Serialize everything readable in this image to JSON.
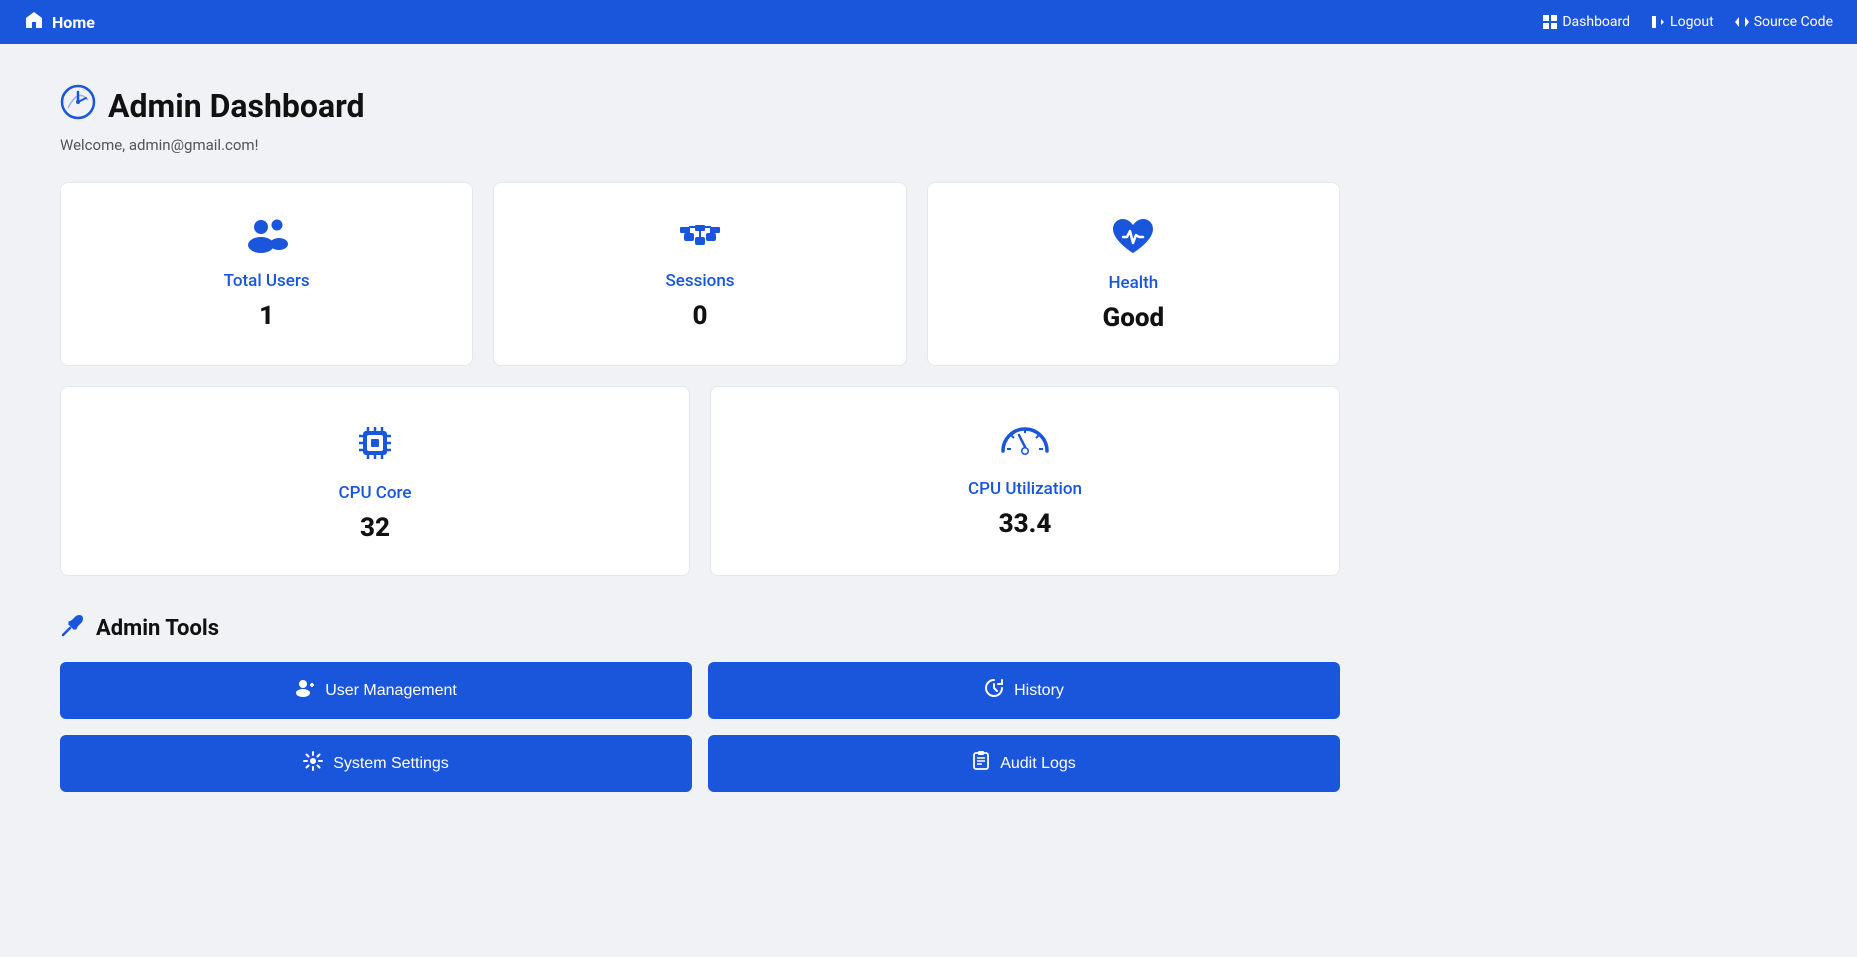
{
  "navbar": {
    "brand": "Home",
    "links": [
      {
        "label": "Dashboard",
        "icon": "dashboard-icon"
      },
      {
        "label": "Logout",
        "icon": "logout-icon"
      },
      {
        "label": "Source Code",
        "icon": "code-icon"
      }
    ]
  },
  "page": {
    "title": "Admin Dashboard",
    "welcome": "Welcome, admin@gmail.com!"
  },
  "stats": {
    "top": [
      {
        "id": "total-users",
        "label": "Total Users",
        "value": "1",
        "icon": "users-icon"
      },
      {
        "id": "sessions",
        "label": "Sessions",
        "value": "0",
        "icon": "sessions-icon"
      },
      {
        "id": "health",
        "label": "Health",
        "value": "Good",
        "icon": "health-icon"
      }
    ],
    "bottom": [
      {
        "id": "cpu-core",
        "label": "CPU Core",
        "value": "32",
        "icon": "cpu-icon"
      },
      {
        "id": "cpu-util",
        "label": "CPU Utilization",
        "value": "33.4",
        "icon": "speedometer-icon"
      }
    ]
  },
  "admin_tools": {
    "section_title": "Admin Tools",
    "buttons": [
      {
        "id": "user-management",
        "label": "User Management",
        "icon": "👥"
      },
      {
        "id": "history",
        "label": "History",
        "icon": "🕐"
      },
      {
        "id": "system-settings",
        "label": "System Settings",
        "icon": "⚙"
      },
      {
        "id": "audit-logs",
        "label": "Audit Logs",
        "icon": "📋"
      }
    ]
  }
}
